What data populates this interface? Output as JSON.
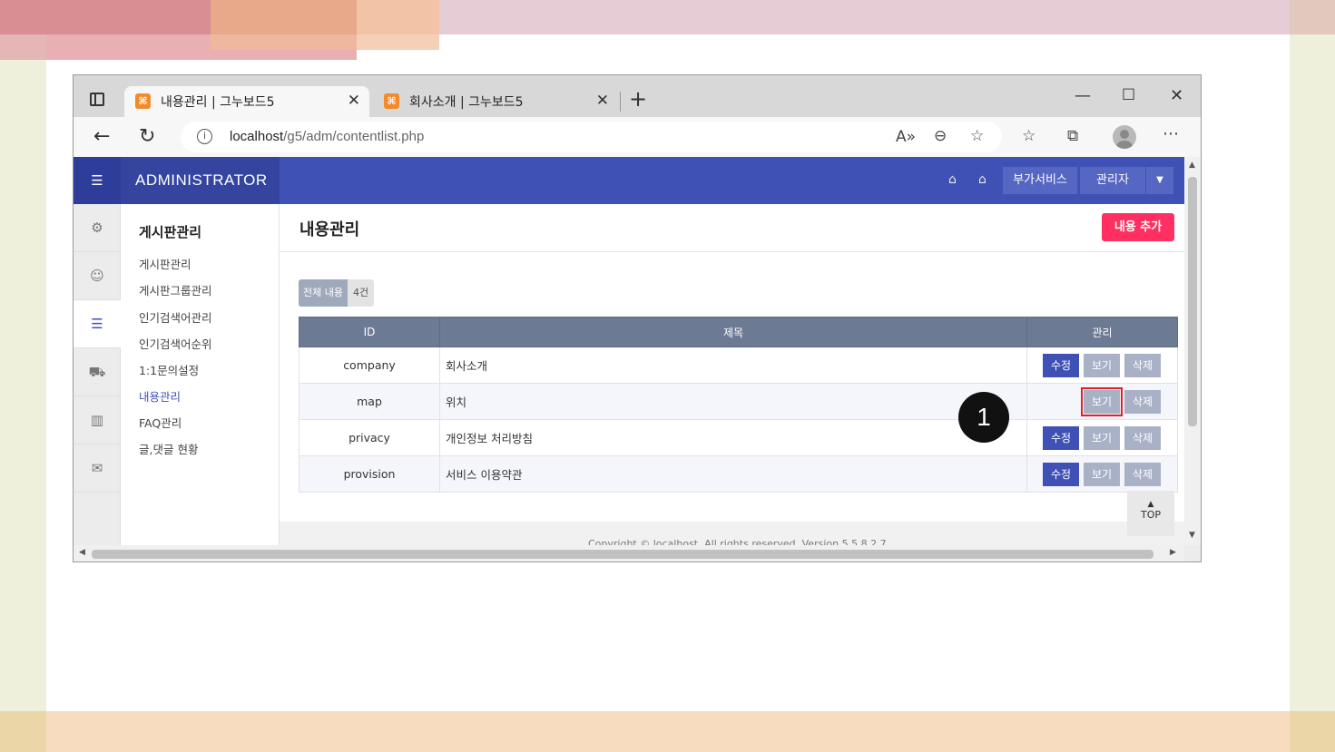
{
  "browser": {
    "tabs": [
      {
        "title": "내용관리 | 그누보드5",
        "active": true
      },
      {
        "title": "회사소개 | 그누보드5",
        "active": false
      }
    ],
    "url_host": "localhost",
    "url_path": "/g5/adm/contentlist.php"
  },
  "header": {
    "brand": "ADMINISTRATOR",
    "service_label": "부가서비스",
    "admin_label": "관리자"
  },
  "sidebar": {
    "section_title": "게시판관리",
    "items": [
      "게시판관리",
      "게시판그룹관리",
      "인기검색어관리",
      "인기검색어순위",
      "1:1문의설정",
      "내용관리",
      "FAQ관리",
      "글,댓글 현황"
    ],
    "active_index": 5
  },
  "main": {
    "page_title": "내용관리",
    "add_button": "내용 추가",
    "count_label": "전체 내용",
    "count_value": "4건",
    "columns": [
      "ID",
      "제목",
      "관리"
    ],
    "rows": [
      {
        "id": "company",
        "title": "회사소개",
        "edit": "수정",
        "view": "보기",
        "delete": "삭제"
      },
      {
        "id": "map",
        "title": "위치",
        "edit": "",
        "view": "보기",
        "delete": "삭제"
      },
      {
        "id": "privacy",
        "title": "개인정보 처리방침",
        "edit": "수정",
        "view": "보기",
        "delete": "삭제"
      },
      {
        "id": "provision",
        "title": "서비스 이용약관",
        "edit": "수정",
        "view": "보기",
        "delete": "삭제"
      }
    ],
    "footer_text": "Copyright © localhost. All rights reserved. Version 5.5.8.2.7",
    "top_button": "TOP"
  },
  "annotation": {
    "callout_number": "1",
    "highlight_color": "#e0202a"
  },
  "colors": {
    "header": "#3f51b5",
    "accent_pink": "#ff3061",
    "table_header": "#6c7a94"
  }
}
